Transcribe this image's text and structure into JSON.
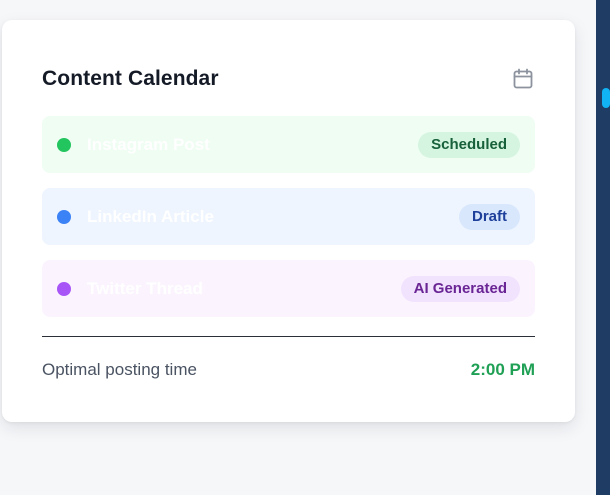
{
  "card": {
    "title": "Content Calendar",
    "header_icon": "calendar-icon"
  },
  "items": [
    {
      "label": "Instagram Post",
      "status": "Scheduled",
      "dot_color": "#22c55e",
      "bg_color": "#effdf3",
      "badge_bg": "#d5f5e0",
      "badge_fg": "#17603a"
    },
    {
      "label": "LinkedIn Article",
      "status": "Draft",
      "dot_color": "#3b82f6",
      "bg_color": "#eef5ff",
      "badge_bg": "#d9e7fd",
      "badge_fg": "#1e3f9a"
    },
    {
      "label": "Twitter Thread",
      "status": "AI Generated",
      "dot_color": "#a855f7",
      "bg_color": "#fbf4ff",
      "badge_bg": "#f1e2fd",
      "badge_fg": "#6a2595"
    }
  ],
  "footer": {
    "label": "Optimal posting time",
    "value": "2:00 PM"
  },
  "colors": {
    "side_panel": "#1f3c64",
    "scroll_thumb": "#11b3f5",
    "accent_green": "#1fa055"
  }
}
